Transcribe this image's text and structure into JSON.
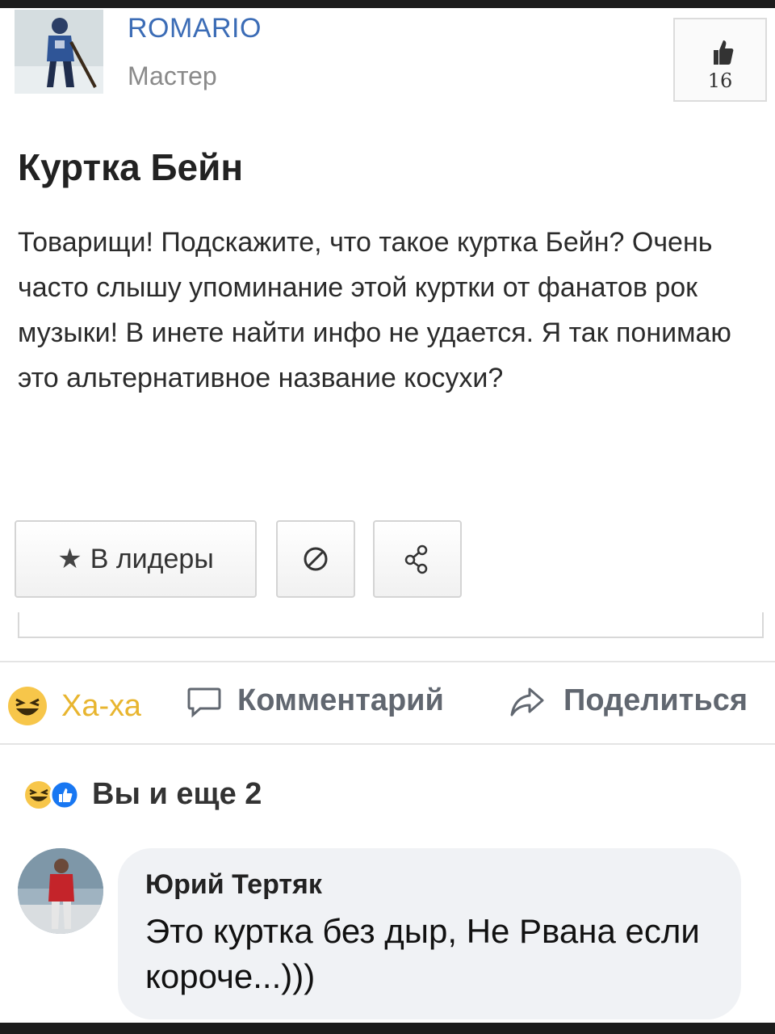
{
  "profile": {
    "username": "ROMARIO",
    "rank": "Мастер",
    "like_count": "16"
  },
  "post": {
    "title": "Куртка Бейн",
    "body": "Товарищи! Подскажите, что такое куртка Бейн? Очень часто слышу упоминание этой куртки от фанатов рок музыки! В инете найти инфо не удается. Я так понимаю это альтернативное название косухи?"
  },
  "buttons": {
    "leaders_label": "В лидеры",
    "leaders_icon": "star-icon",
    "block_icon": "block-icon",
    "share_icon": "share-nodes-icon"
  },
  "actions": {
    "haha_label": "Ха-ха",
    "comment_label": "Комментарий",
    "share_label": "Поделиться"
  },
  "reactions": {
    "summary": "Вы и еще 2",
    "icons": [
      "haha-icon",
      "like-icon"
    ]
  },
  "comment": {
    "author": "Юрий Тертяк",
    "text": "Это куртка без дыр, Не Рвана если короче...)))"
  },
  "colors": {
    "username": "#3b6cb6",
    "haha": "#e8b52f",
    "like_blue": "#1877f2",
    "action_text": "#616770",
    "bubble_bg": "#f0f2f5"
  }
}
